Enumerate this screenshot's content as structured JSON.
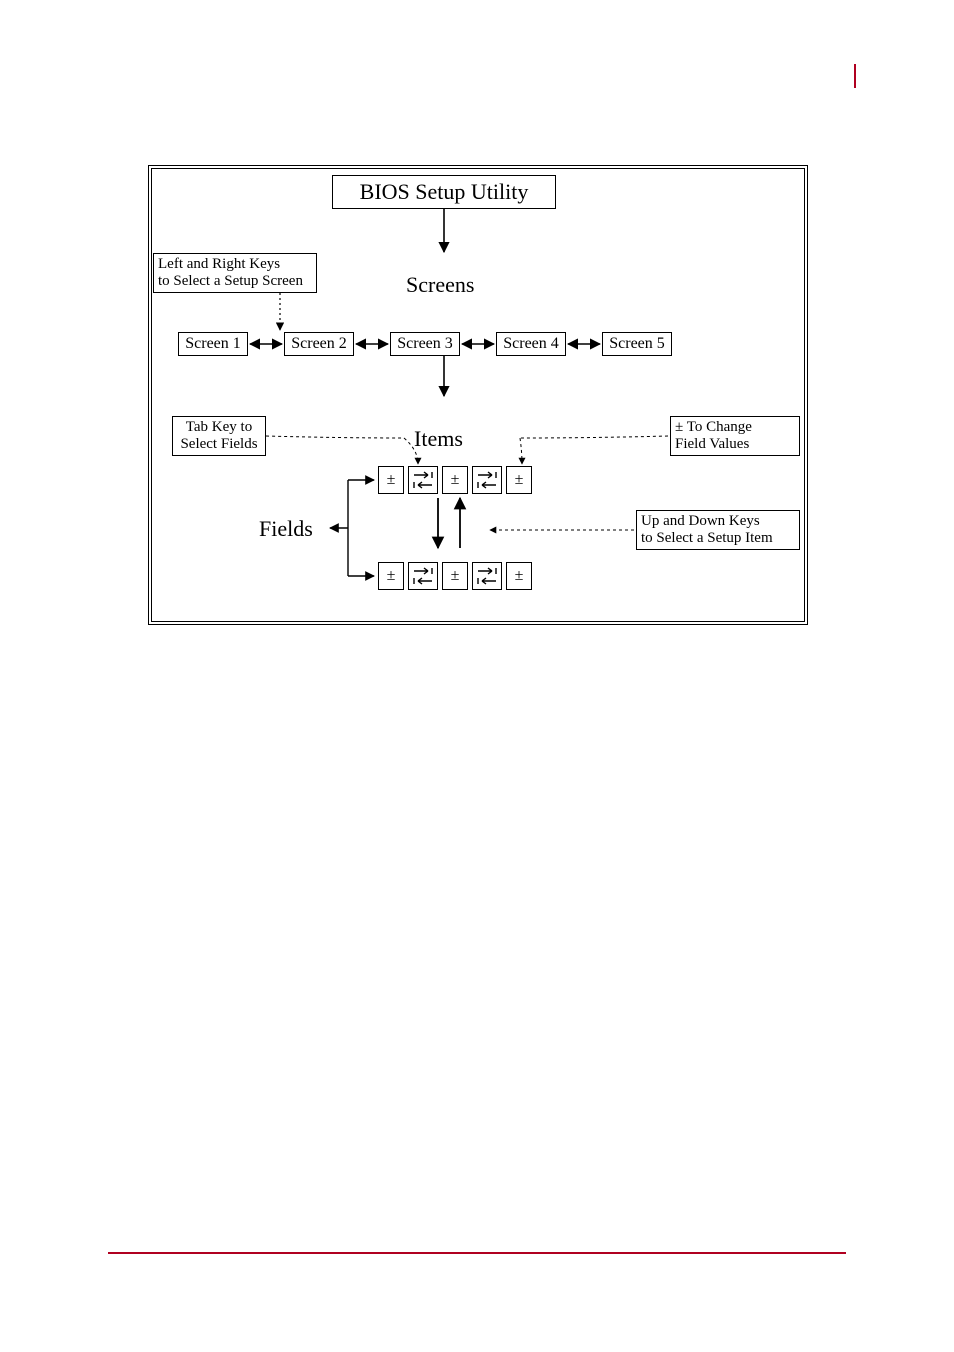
{
  "cursor": {
    "visible": true
  },
  "diagram": {
    "title": "BIOS Setup Utility",
    "labels": {
      "screens": "Screens",
      "items": "Items",
      "fields": "Fields"
    },
    "hints": {
      "left_right": "Left and Right Keys\nto Select a Setup Screen",
      "tab": "Tab Key to\nSelect Fields",
      "plus_minus": "± To Change\nField Values",
      "up_down": "Up and Down Keys\nto Select a Setup Item"
    },
    "screens": [
      "Screen 1",
      "Screen 2",
      "Screen 3",
      "Screen 4",
      "Screen 5"
    ],
    "pm_symbol": "±"
  }
}
